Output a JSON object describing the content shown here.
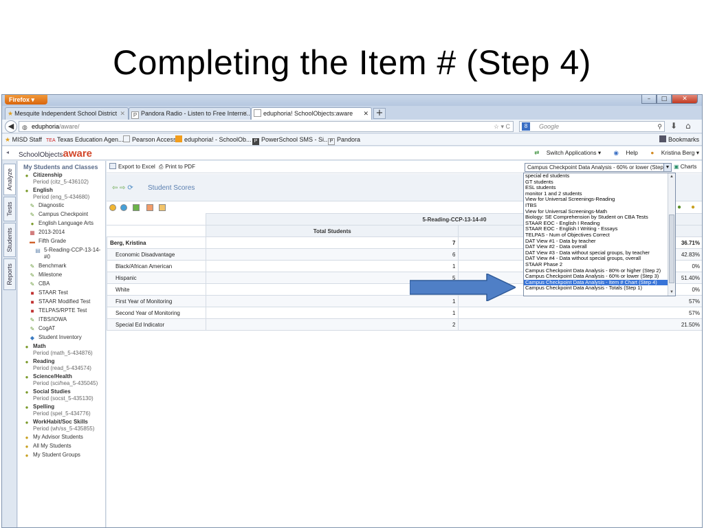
{
  "slide": {
    "title": "Completing the Item # (Step 4)"
  },
  "browser": {
    "app_button": "Firefox",
    "tabs": [
      {
        "label": "Mesquite Independent School District",
        "icon": "star-icon"
      },
      {
        "label": "Pandora Radio - Listen to Free Interne...",
        "icon": "P"
      },
      {
        "label": "eduphoria! SchoolObjects:aware",
        "icon": "page-icon",
        "active": true
      }
    ],
    "url_host": "eduphoria",
    "url_path": "/aware/",
    "search_placeholder": "Google",
    "bookmarks": [
      "MISD Staff",
      "Texas Education Agen...",
      "Pearson Access",
      "eduphoria! - SchoolOb...",
      "PowerSchool SMS - Si...",
      "Pandora"
    ],
    "bookmarks_menu": "Bookmarks"
  },
  "app": {
    "logo_small": "SchoolObjects",
    "logo_big": "aware",
    "header_links": {
      "switch": "Switch Applications ▾",
      "help": "Help",
      "user": "Kristina Berg ▾"
    },
    "vtabs": [
      "Analyze",
      "Tests",
      "Students",
      "Reports"
    ]
  },
  "sidebar": {
    "title": "My Students and Classes",
    "items": [
      {
        "name": "Citizenship",
        "period": "Period (citz_5-436102)",
        "level": 0,
        "icon": "book-icon"
      },
      {
        "name": "English",
        "period": "Period (eng_5-434680)",
        "level": 0,
        "icon": "book-icon"
      },
      {
        "label": "Diagnostic",
        "level": 1,
        "icon": "pencil-icon"
      },
      {
        "label": "Campus Checkpoint",
        "level": 1,
        "icon": "pencil-icon"
      },
      {
        "label": "English Language Arts",
        "level": 1,
        "icon": "book-icon"
      },
      {
        "label": "2013-2014",
        "level": 1,
        "icon": "calendar-icon"
      },
      {
        "label": "Fifth Grade",
        "level": 1,
        "icon": "grade-icon"
      },
      {
        "label": "5-Reading-CCP-13-14-#0",
        "level": 2,
        "icon": "doc-icon"
      },
      {
        "label": "Benchmark",
        "level": 1,
        "icon": "pencil-icon"
      },
      {
        "label": "Milestone",
        "level": 1,
        "icon": "pencil-icon"
      },
      {
        "label": "CBA",
        "level": 1,
        "icon": "pencil-icon"
      },
      {
        "label": "STAAR Test",
        "level": 1,
        "icon": "state-icon"
      },
      {
        "label": "STAAR Modified Test",
        "level": 1,
        "icon": "state-icon"
      },
      {
        "label": "TELPAS/RPTE Test",
        "level": 1,
        "icon": "state-icon"
      },
      {
        "label": "ITBS/IOWA",
        "level": 1,
        "icon": "pencil-icon"
      },
      {
        "label": "CogAT",
        "level": 1,
        "icon": "pencil-icon"
      },
      {
        "label": "Student Inventory",
        "level": 1,
        "icon": "inventory-icon"
      },
      {
        "name": "Math",
        "period": "Period (math_5-434876)",
        "level": 0,
        "icon": "book-icon"
      },
      {
        "name": "Reading",
        "period": "Period (read_5-434574)",
        "level": 0,
        "icon": "book-icon"
      },
      {
        "name": "Science/Health",
        "period": "Period (sci/hea_5-435045)",
        "level": 0,
        "icon": "book-icon"
      },
      {
        "name": "Social Studies",
        "period": "Period (socst_5-435130)",
        "level": 0,
        "icon": "book-icon"
      },
      {
        "name": "Spelling",
        "period": "Period (spel_5-434776)",
        "level": 0,
        "icon": "book-icon"
      },
      {
        "name": "WorkHabit/Soc Skills",
        "period": "Period (wh/ss_5-435855)",
        "level": 0,
        "icon": "book-icon"
      },
      {
        "label": "My Advisor Students",
        "level": 0,
        "icon": "people-icon"
      },
      {
        "label": "All My Students",
        "level": 0,
        "icon": "people-icon"
      },
      {
        "label": "My Student Groups",
        "level": 0,
        "icon": "people-icon"
      }
    ]
  },
  "main": {
    "toolbar": {
      "export": "Export to Excel",
      "print": "Print to PDF",
      "charts": "Charts"
    },
    "view_select": "Campus Checkpoint Data Analysis - 60% or lower (Step 3)",
    "section_title": "Student Scores",
    "table": {
      "test_header": "5-Reading-CCP-13-14-#0",
      "total_header": "Total Students",
      "rows": [
        {
          "label": "Berg, Kristina",
          "total": "7",
          "pct": "36.71%",
          "top": true
        },
        {
          "label": "Economic Disadvantage",
          "total": "6",
          "pct": "42.83%"
        },
        {
          "label": "Black/African American",
          "total": "1",
          "pct": "0%"
        },
        {
          "label": "Hispanic",
          "total": "5",
          "pct": "51.40%"
        },
        {
          "label": "White",
          "total": "",
          "pct": "0%"
        },
        {
          "label": "First Year of Monitoring",
          "total": "1",
          "pct": "57%"
        },
        {
          "label": "Second Year of Monitoring",
          "total": "1",
          "pct": "57%"
        },
        {
          "label": "Special Ed Indicator",
          "total": "2",
          "pct": "21.50%"
        }
      ]
    }
  },
  "dropdown": {
    "options": [
      "special ed students",
      "GT students",
      "ESL students",
      "monitor 1 and 2 students",
      "View for Universal Screenings-Reading",
      "ITBS",
      "View for Universal Screenings-Math",
      "Biology: SE Comprehension by Student on CBA Tests",
      "STAAR EOC - English I Reading",
      "STAAR EOC - English I Writing - Essays",
      "TELPAS - Num of Objectives Correct",
      "DAT View #1 - Data by teacher",
      "DAT View #2 - Data overall",
      "DAT View #3 - Data without special groups, by teacher",
      "DAT View #4 - Data without special groups, overall",
      "STAAR Phase 2",
      "Campus Checkpoint Data Analysis - 80% or higher (Step 2)",
      "Campus Checkpoint Data Analysis - 60% or lower (Step 3)",
      "Campus Checkpoint Data Analysis - Item # Chart (Step 4)",
      "Campus Checkpoint Data Analysis - Totals (Step 1)"
    ],
    "selected_index": 18
  },
  "colors": {
    "accent": "#3874d8",
    "arrow": "#4f7fc6",
    "aware_logo": "#d2472a"
  }
}
